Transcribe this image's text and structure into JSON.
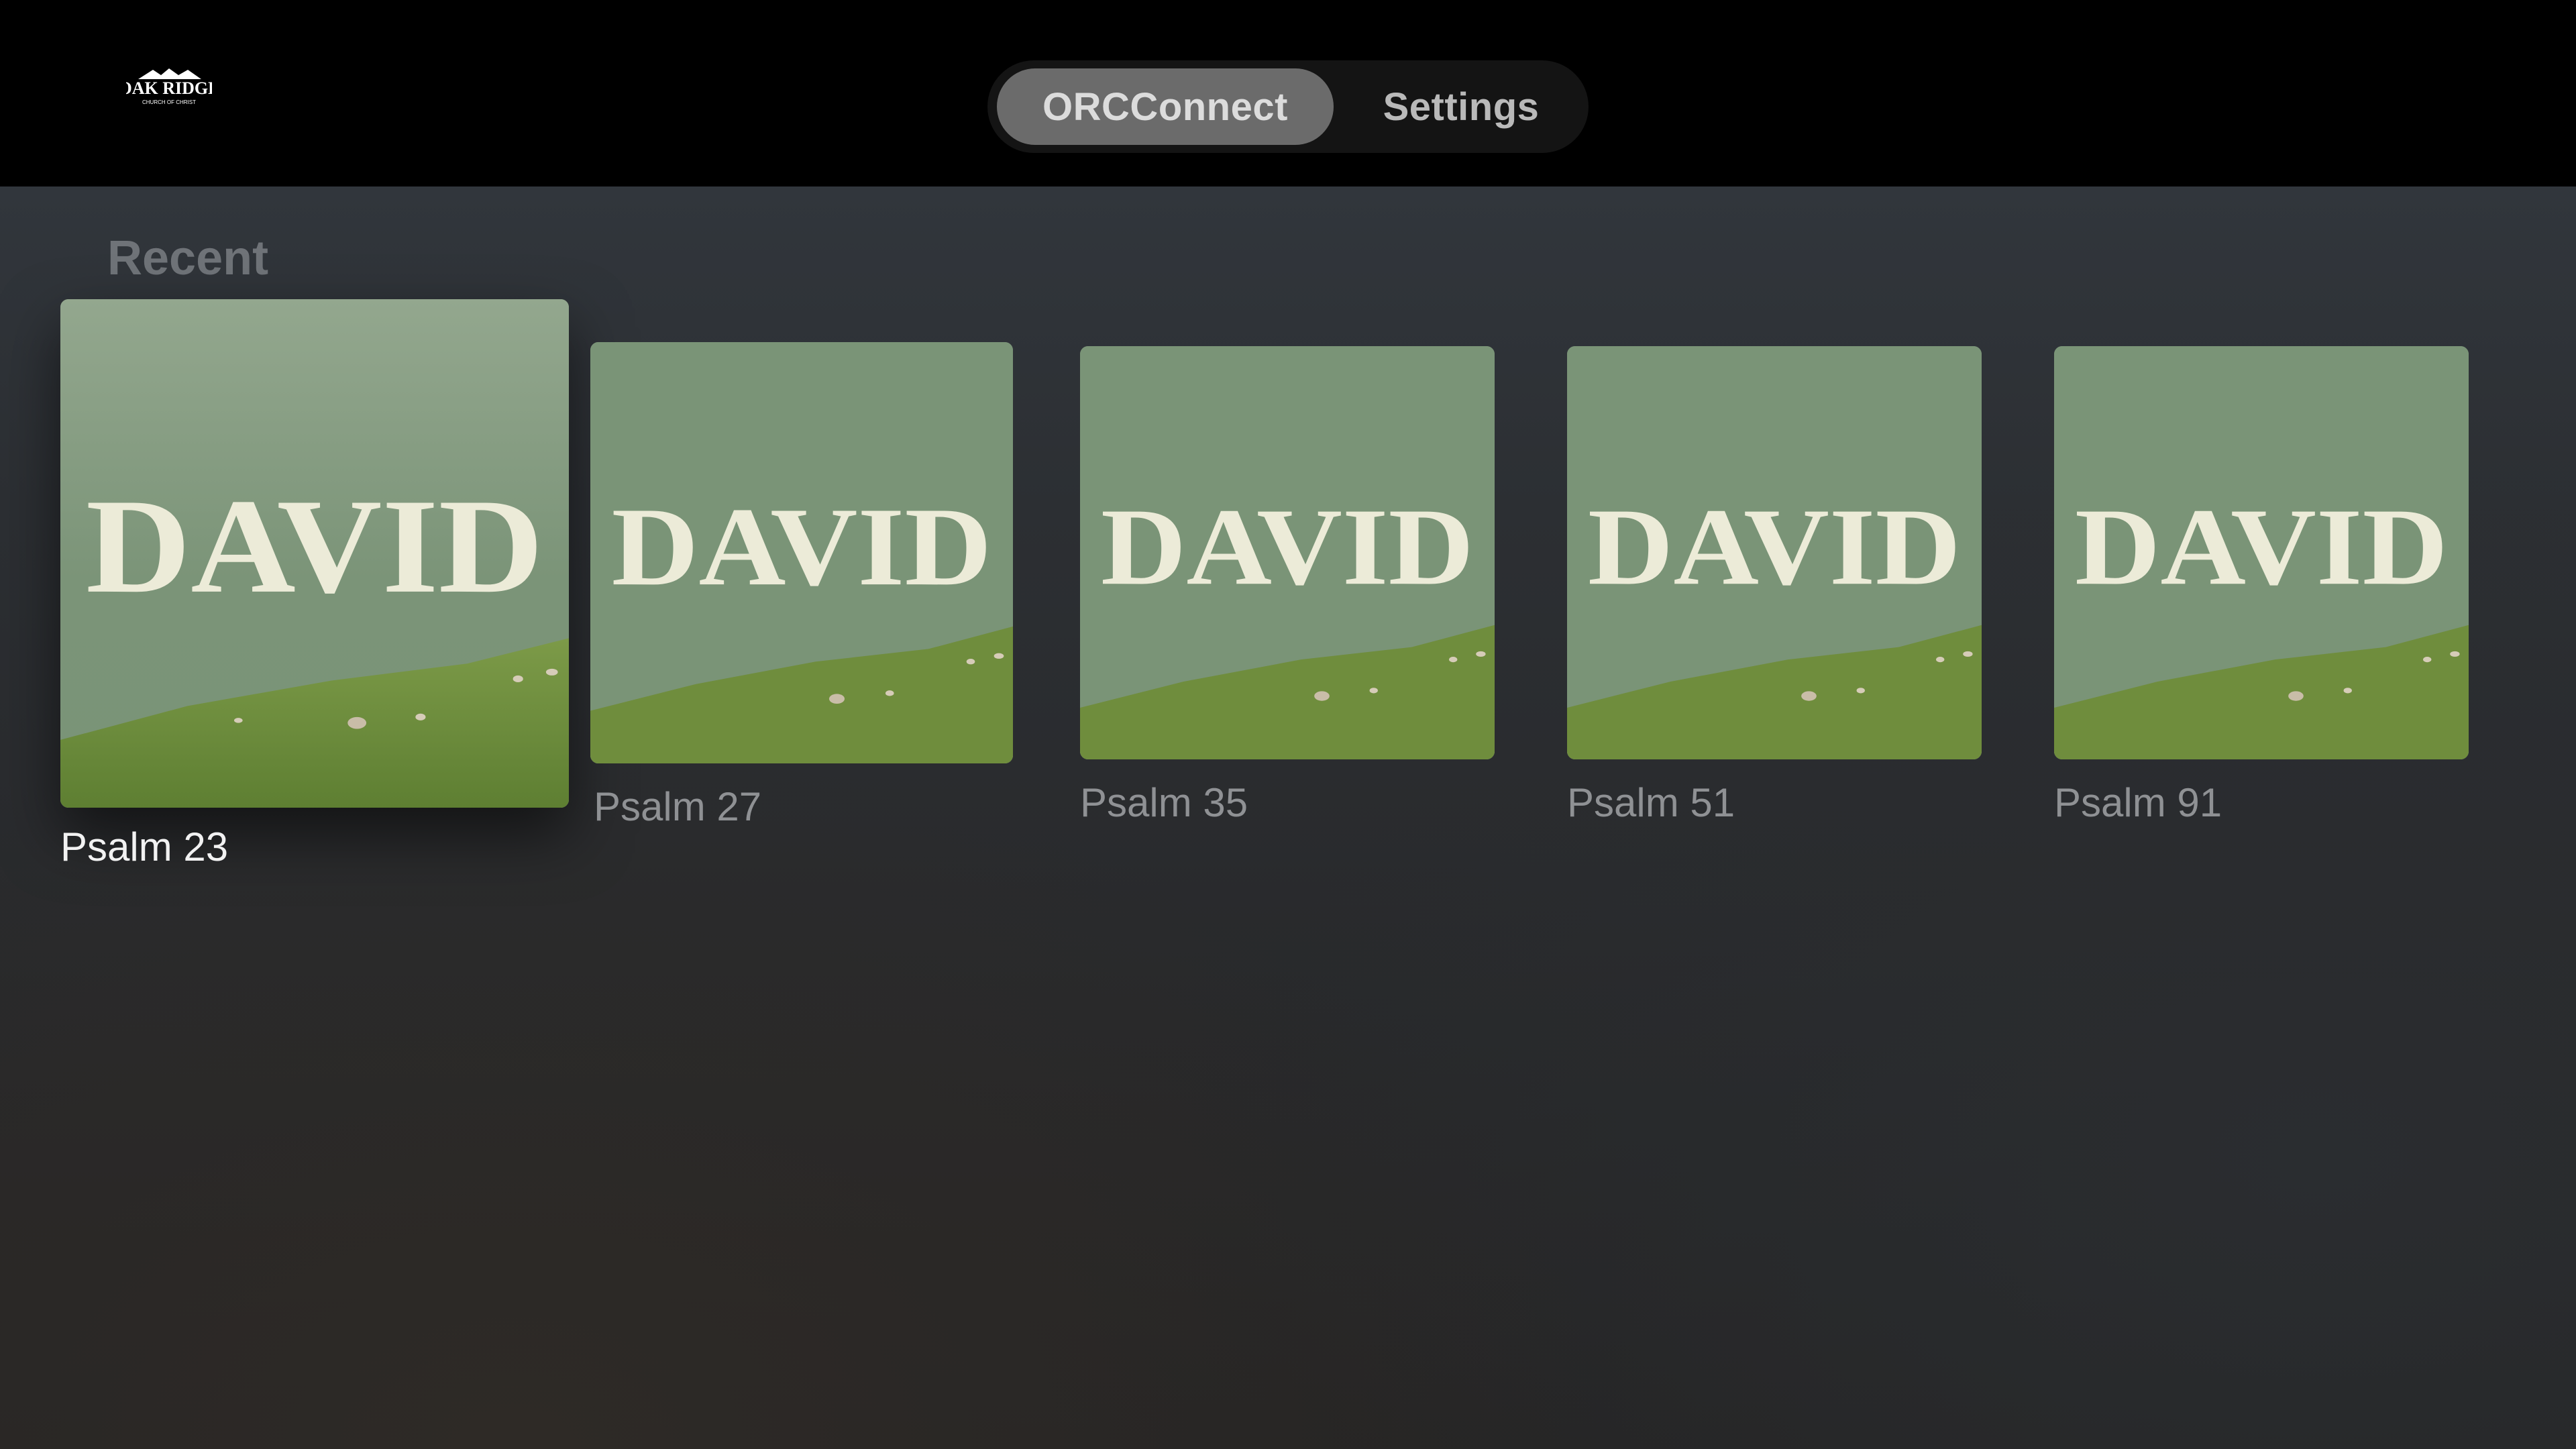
{
  "header": {
    "logo_alt": "Oak Ridge Church of Christ",
    "logo_text": "OAK RIDGE",
    "logo_subtext": "CHURCH OF CHRIST",
    "tabs": [
      {
        "label": "ORCConnect",
        "selected": true
      },
      {
        "label": "Settings",
        "selected": false
      }
    ]
  },
  "recent": {
    "title": "Recent",
    "items": [
      {
        "poster_title": "DAVID",
        "label": "Psalm 23",
        "focused": true
      },
      {
        "poster_title": "DAVID",
        "label": "Psalm 27",
        "focused": false
      },
      {
        "poster_title": "DAVID",
        "label": "Psalm 35",
        "focused": false
      },
      {
        "poster_title": "DAVID",
        "label": "Psalm 51",
        "focused": false
      },
      {
        "poster_title": "DAVID",
        "label": "Psalm 91",
        "focused": false
      }
    ]
  },
  "colors": {
    "poster_sky": "#7a9478",
    "poster_grass": "#6e8a3c",
    "poster_text": "#ecebd8",
    "topbar": "#000000"
  }
}
